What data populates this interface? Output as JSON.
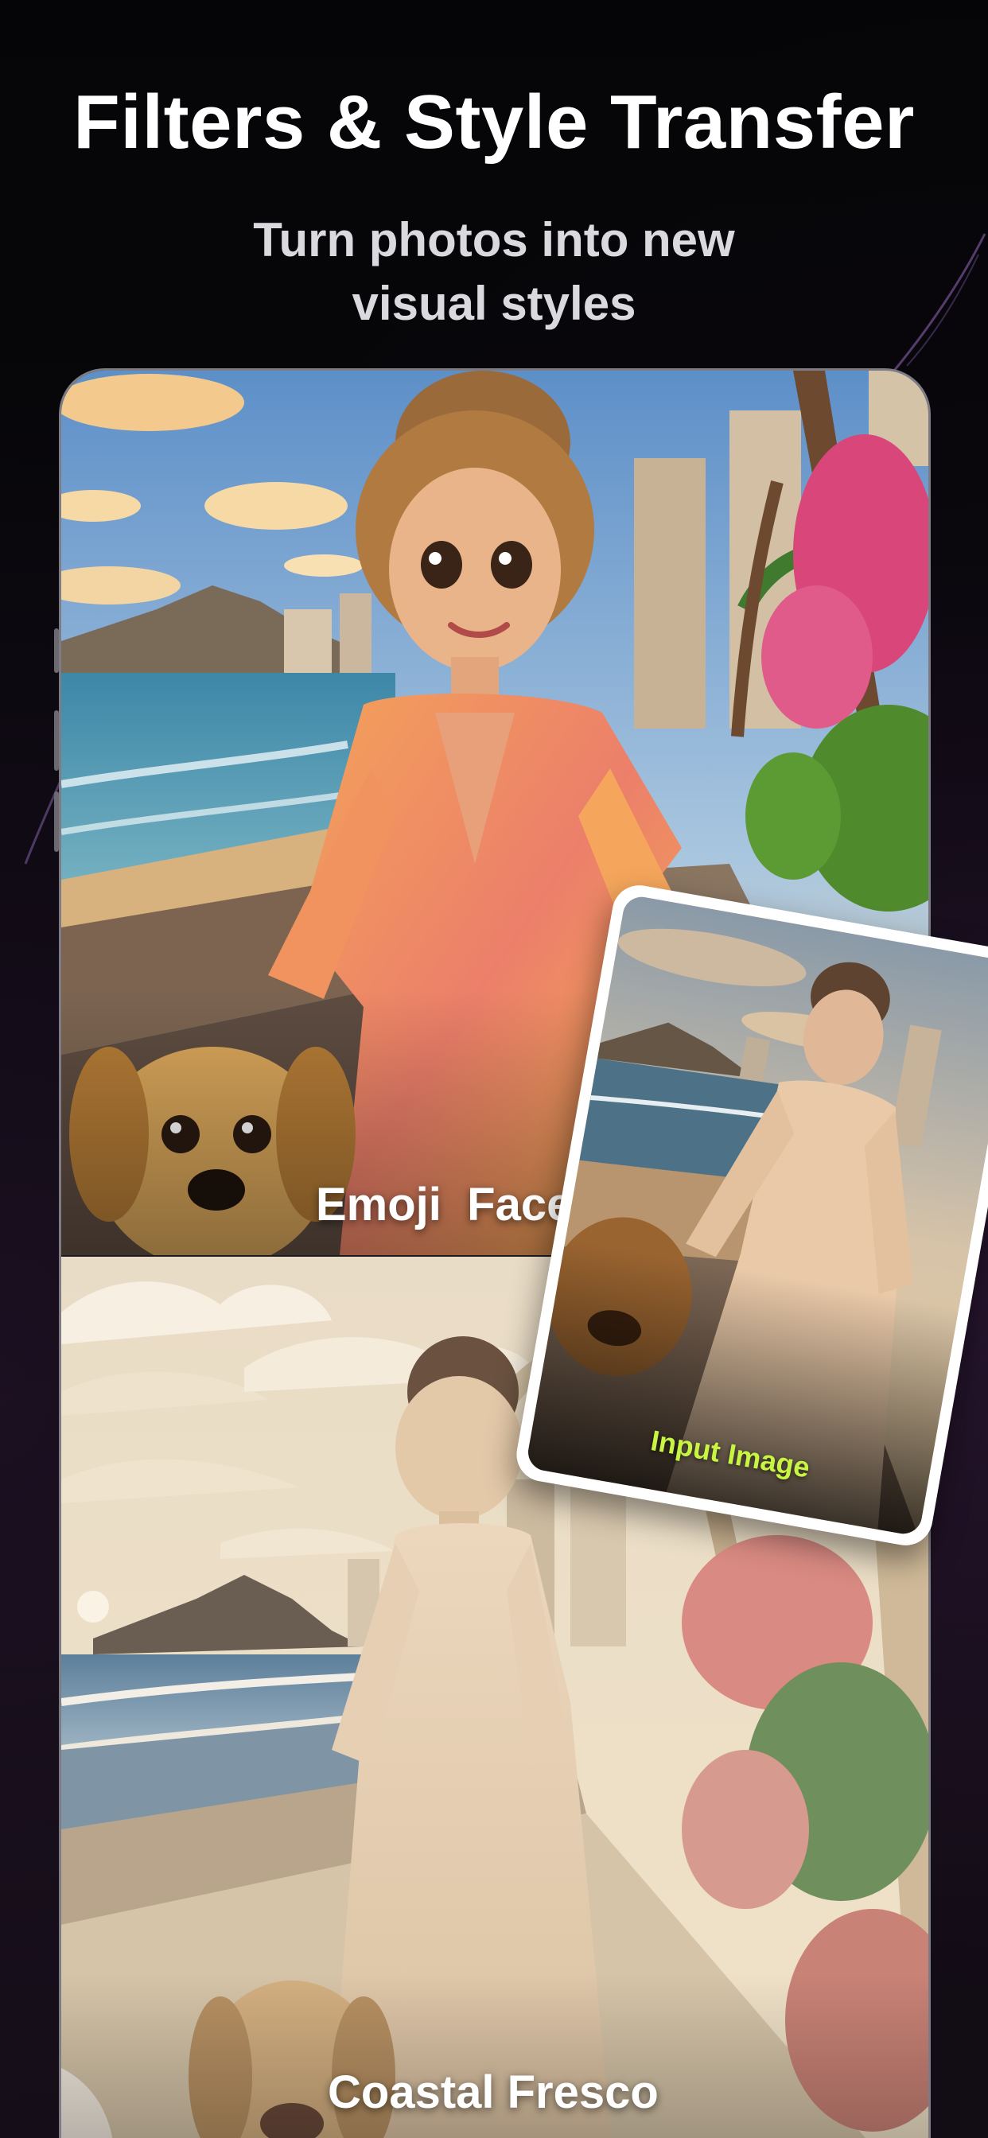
{
  "header": {
    "title": "Filters & Style Transfer",
    "subtitle": "Turn photos into new visual styles"
  },
  "styles": [
    {
      "label": "Emoji  Face"
    },
    {
      "label": "Coastal Fresco"
    }
  ],
  "input_card": {
    "label": "Input Image"
  },
  "colors": {
    "background": "#07070a",
    "title_text": "#ffffff",
    "subtitle_text": "#d9d9de",
    "input_label": "#c8f542",
    "card_border": "#ffffff",
    "phone_frame": "#7d7b83"
  }
}
